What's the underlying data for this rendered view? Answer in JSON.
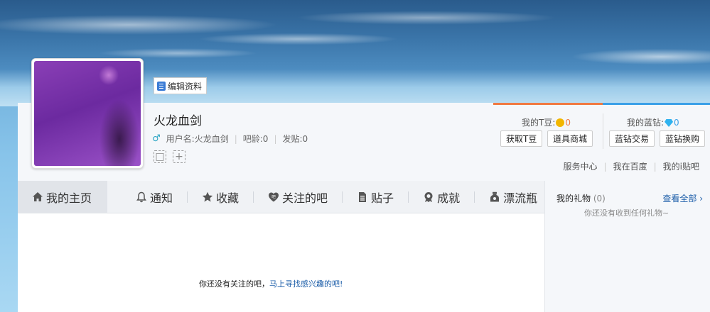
{
  "profile": {
    "edit_label": "编辑资料",
    "username": "火龙血剑",
    "meta": {
      "user_label": "用户名:火龙血剑",
      "age_label": "吧龄:0",
      "posts_label": "发贴:0"
    }
  },
  "tdou": {
    "title": "我的T豆:",
    "value": "0",
    "buttons": [
      "获取T豆",
      "道具商城"
    ]
  },
  "lanzuan": {
    "title": "我的蓝钻:",
    "value": "0",
    "buttons": [
      "蓝钻交易",
      "蓝钻换购"
    ]
  },
  "links": [
    "服务中心",
    "我在百度",
    "我的i贴吧"
  ],
  "tabs": [
    {
      "label": "我的主页",
      "icon": "home-icon"
    },
    {
      "label": "通知",
      "icon": "bell-icon"
    },
    {
      "label": "收藏",
      "icon": "star-icon"
    },
    {
      "label": "关注的吧",
      "icon": "heart-tieba-icon"
    },
    {
      "label": "贴子",
      "icon": "document-icon"
    },
    {
      "label": "成就",
      "icon": "medal-icon"
    },
    {
      "label": "漂流瓶",
      "icon": "bottle-icon"
    }
  ],
  "content": {
    "empty_text": "你还没有关注的吧，",
    "empty_link": "马上寻找感兴趣的吧!"
  },
  "gifts": {
    "title": "我的礼物",
    "count": "(0)",
    "view_all": "查看全部",
    "empty": "你还没有收到任何礼物~"
  },
  "colors": {
    "tdou_accent": "#f07a42",
    "lanzuan_accent": "#3ba0e8",
    "link": "#1a5ca8"
  }
}
